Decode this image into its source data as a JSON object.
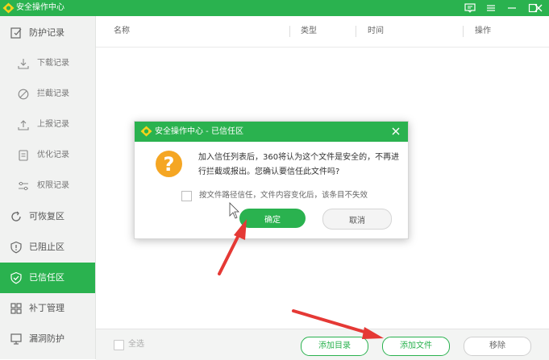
{
  "app": {
    "title": "安全操作中心"
  },
  "sidebar": {
    "items": [
      {
        "label": "防护记录",
        "icon": "edit-check-icon"
      },
      {
        "label": "下载记录",
        "icon": "download-icon"
      },
      {
        "label": "拦截记录",
        "icon": "block-icon"
      },
      {
        "label": "上报记录",
        "icon": "upload-icon"
      },
      {
        "label": "优化记录",
        "icon": "document-icon"
      },
      {
        "label": "权限记录",
        "icon": "permission-sliders-icon"
      },
      {
        "label": "可恢复区",
        "icon": "restore-icon"
      },
      {
        "label": "已阻止区",
        "icon": "shield-alert-icon"
      },
      {
        "label": "已信任区",
        "icon": "shield-check-icon"
      },
      {
        "label": "补丁管理",
        "icon": "grid-icon"
      },
      {
        "label": "漏洞防护",
        "icon": "monitor-icon"
      }
    ],
    "active": "已信任区"
  },
  "table": {
    "columns": [
      "名称",
      "类型",
      "时间",
      "操作"
    ]
  },
  "footer": {
    "select_all": "全选",
    "add_dir": "添加目录",
    "add_file": "添加文件",
    "remove": "移除"
  },
  "dialog": {
    "title": "安全操作中心 - 已信任区",
    "icon": "question-icon",
    "message": "加入信任列表后，360将认为这个文件是安全的，不再进行拦截或报出。您确认要信任此文件吗?",
    "checkbox_label": "按文件路径信任，文件内容变化后，该条目不失效",
    "ok": "确定",
    "cancel": "取消"
  },
  "colors": {
    "accent": "#2ab24f",
    "warning": "#f5a623",
    "annotation": "#e53935"
  }
}
